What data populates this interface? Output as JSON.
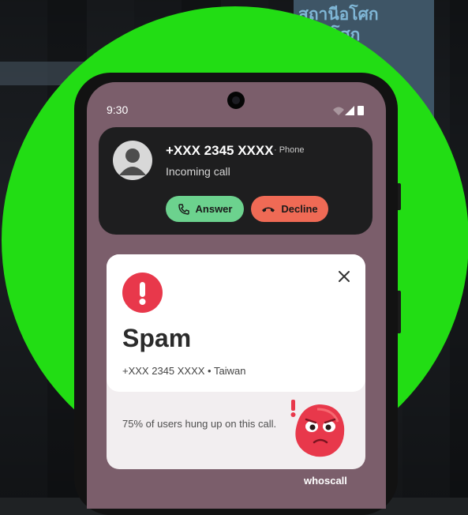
{
  "background": {
    "sign_text_line1": "สถานีอโศก",
    "sign_text_line2": "สุขุมโศก",
    "accent_circle_color": "#22dd14"
  },
  "status_bar": {
    "time": "9:30",
    "icons": [
      "wifi-icon",
      "signal-icon",
      "battery-icon"
    ]
  },
  "incoming_call": {
    "number": "+XXX 2345 XXXX",
    "source": "· Phone",
    "status": "Incoming call",
    "answer_label": "Answer",
    "decline_label": "Decline",
    "answer_color": "#6cd28e",
    "decline_color": "#ef6a55"
  },
  "spam_alert": {
    "title": "Spam",
    "subtitle": "+XXX 2345 XXXX • Taiwan",
    "stat": "75% of users hung up on this call.",
    "warning_color": "#e8384b"
  },
  "brand": "whoscall"
}
